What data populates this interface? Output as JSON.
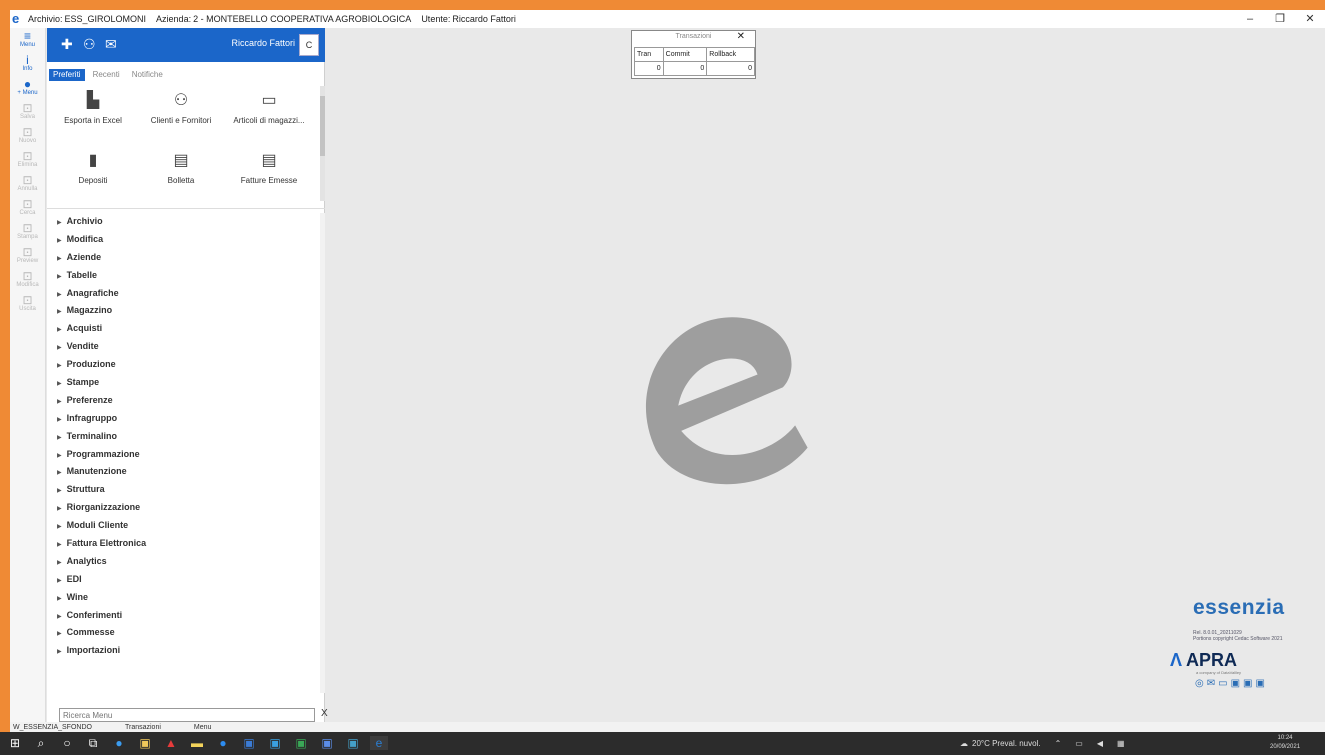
{
  "window": {
    "archive_label": "Archivio:",
    "archive_value": "ESS_GIROLOMONI",
    "company_label": "Azienda:",
    "company_value": "2 - MONTEBELLO COOPERATIVA AGROBIOLOGICA",
    "user_label": "Utente:",
    "user_value": "Riccardo Fattori",
    "minimize": "–",
    "restore": "❐",
    "close": "✕"
  },
  "leftnav": [
    {
      "icon": "≡",
      "label": "Menu",
      "enabled": true
    },
    {
      "icon": "i",
      "label": "Info",
      "enabled": true
    },
    {
      "icon": "●",
      "label": "+ Menu",
      "enabled": true
    },
    {
      "icon": "⊡",
      "label": "Salva",
      "enabled": false
    },
    {
      "icon": "⊡",
      "label": "Nuovo",
      "enabled": false
    },
    {
      "icon": "⊡",
      "label": "Elimina",
      "enabled": false
    },
    {
      "icon": "⊡",
      "label": "Annulla",
      "enabled": false
    },
    {
      "icon": "⊡",
      "label": "Cerca",
      "enabled": false
    },
    {
      "icon": "⊡",
      "label": "Stampa",
      "enabled": false
    },
    {
      "icon": "⊡",
      "label": "Preview",
      "enabled": false
    },
    {
      "icon": "⊡",
      "label": "Modifica",
      "enabled": false
    },
    {
      "icon": "⊡",
      "label": "Uscita",
      "enabled": false
    }
  ],
  "panel": {
    "user_name": "Riccardo Fattori",
    "spin_value": "C",
    "tabs": [
      "Preferiti",
      "Recenti",
      "Notifiche"
    ],
    "favorites": [
      {
        "icon": "▙",
        "label": "Esporta in Excel"
      },
      {
        "icon": "⚇",
        "label": "Clienti e Fornitori"
      },
      {
        "icon": "▭",
        "label": "Articoli di magazzi..."
      },
      {
        "icon": "▮",
        "label": "Depositi"
      },
      {
        "icon": "▤",
        "label": "Bolletta"
      },
      {
        "icon": "▤",
        "label": "Fatture Emesse"
      }
    ],
    "menu": [
      "Archivio",
      "Modifica",
      "Aziende",
      "Tabelle",
      "Anagrafiche",
      "Magazzino",
      "Acquisti",
      "Vendite",
      "Produzione",
      "Stampe",
      "Preferenze",
      "Infragruppo",
      "Terminalino",
      "Programmazione",
      "Manutenzione",
      "Struttura",
      "Riorganizzazione",
      "Moduli Cliente",
      "Fattura Elettronica",
      "Analytics",
      "EDI",
      "Wine",
      "Conferimenti",
      "Commesse",
      "Importazioni"
    ],
    "search_placeholder": "Ricerca Menu",
    "search_clear": "X"
  },
  "transactions": {
    "title": "Transazioni",
    "close": "✕",
    "headers": [
      "Tran",
      "Commit",
      "Rollback"
    ],
    "values": [
      "0",
      "0",
      "0"
    ]
  },
  "branding": {
    "product": "essenzia",
    "release": "Rel. 8.0.01_20211029",
    "copyright": "Portions copyright Cedac Software 2021",
    "vendor": "APRA",
    "vendor_sub": "a company of DataVallley"
  },
  "statusbar": {
    "items": [
      "W_ESSENZIA_SFONDO",
      "Transazioni",
      "Menu"
    ]
  },
  "taskbar": {
    "weather": "20°C Preval. nuvol.",
    "time": "10:24",
    "date": "20/09/2021"
  },
  "colors": {
    "accent": "#1b66c9",
    "frame": "#ef8a35",
    "taskbar": "#2c2c2c"
  }
}
